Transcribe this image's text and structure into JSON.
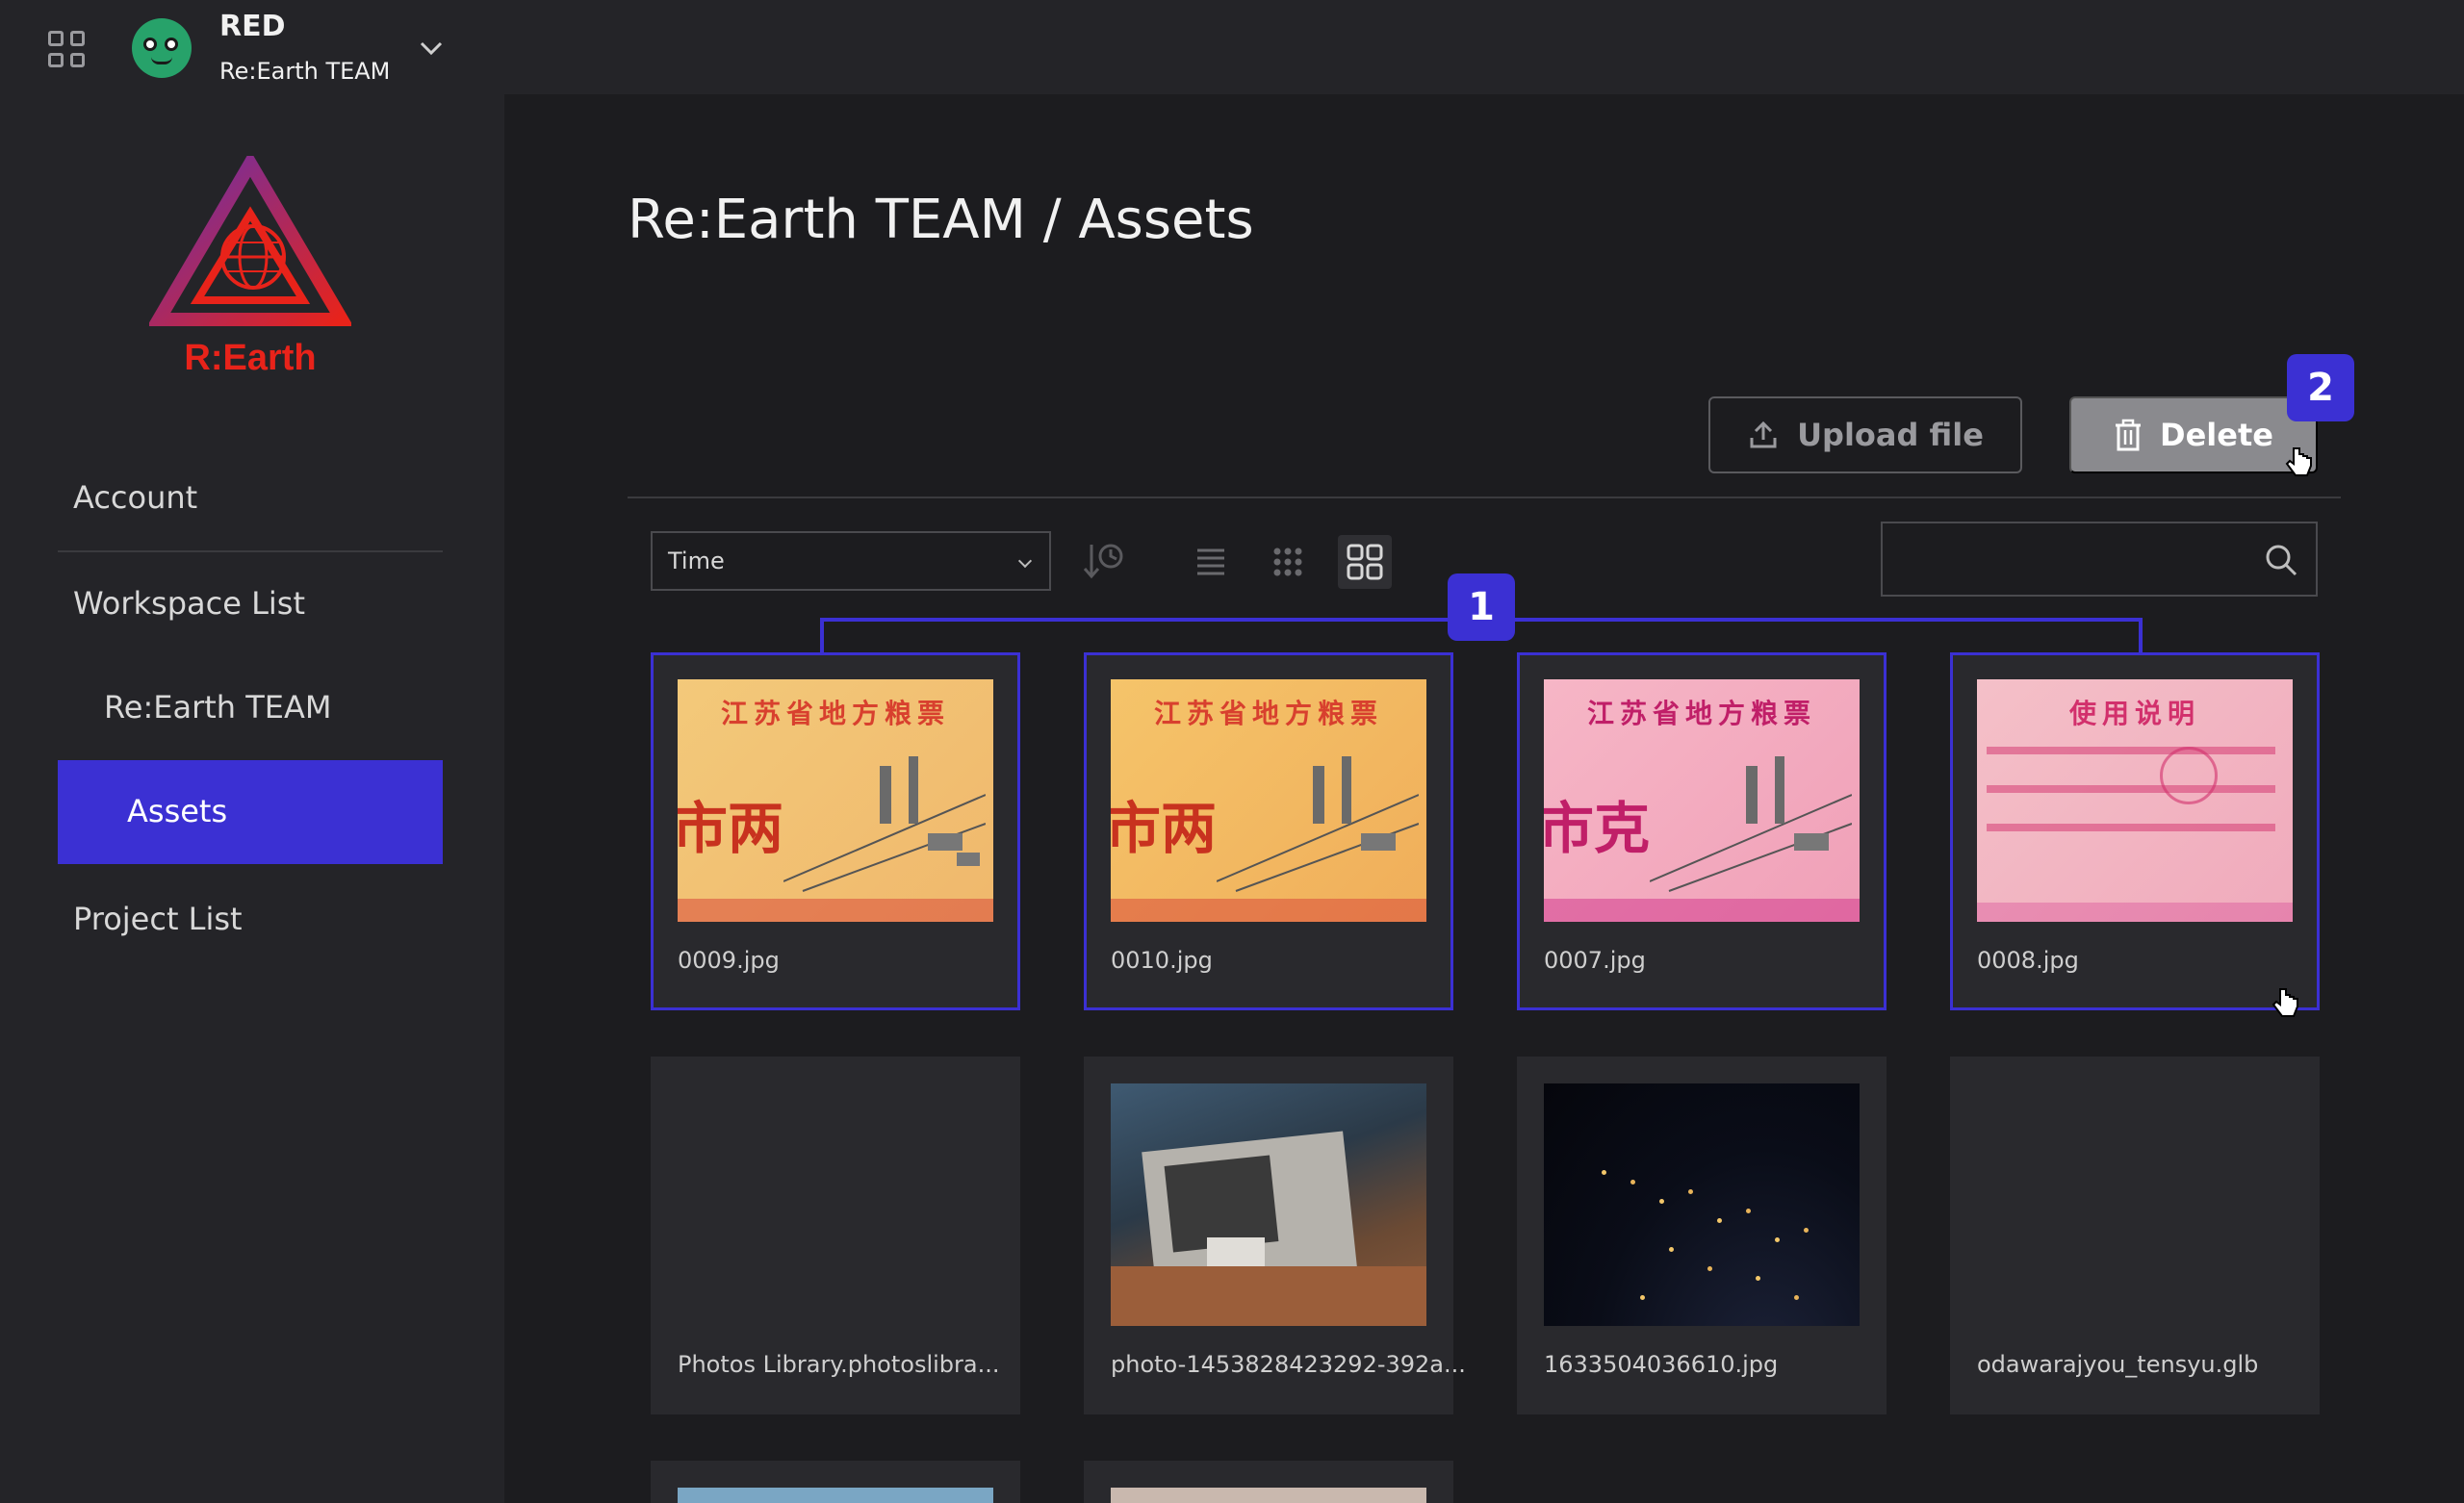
{
  "header": {
    "user_name": "RED",
    "team_name": "Re:Earth TEAM"
  },
  "sidebar": {
    "logo_text": "R:Earth",
    "items": [
      {
        "label": "Account"
      },
      {
        "label": "Workspace List"
      },
      {
        "label": "Re:Earth TEAM"
      },
      {
        "label": "Assets",
        "active": true
      },
      {
        "label": "Project List"
      }
    ]
  },
  "main": {
    "title": "Re:Earth TEAM / Assets",
    "upload_label": "Upload file",
    "delete_label": "Delete",
    "sort_value": "Time",
    "search_placeholder": ""
  },
  "annotations": {
    "badge_1": "1",
    "badge_2": "2"
  },
  "assets": [
    {
      "name": "0009.jpg",
      "selected": true,
      "thumb": "ticket-yellow",
      "header_text": "江苏省地方粮票",
      "big_text": "市两"
    },
    {
      "name": "0010.jpg",
      "selected": true,
      "thumb": "ticket-yellow",
      "header_text": "江苏省地方粮票",
      "big_text": "市两"
    },
    {
      "name": "0007.jpg",
      "selected": true,
      "thumb": "ticket-pink",
      "header_text": "江苏省地方粮票",
      "big_text": "市克"
    },
    {
      "name": "0008.jpg",
      "selected": true,
      "thumb": "ticket-pink-back",
      "header_text": "使用说明",
      "big_text": ""
    },
    {
      "name": "Photos Library.photoslibra...",
      "selected": false,
      "thumb": "none"
    },
    {
      "name": "photo-1453828423292-392a...",
      "selected": false,
      "thumb": "photo-box"
    },
    {
      "name": "1633504036610.jpg",
      "selected": false,
      "thumb": "earth-night"
    },
    {
      "name": "odawarajyou_tensyu.glb",
      "selected": false,
      "thumb": "none"
    }
  ],
  "colors": {
    "accent": "#3b30d3",
    "background": "#1c1c1f",
    "panel": "#242428",
    "card": "#29292d"
  }
}
